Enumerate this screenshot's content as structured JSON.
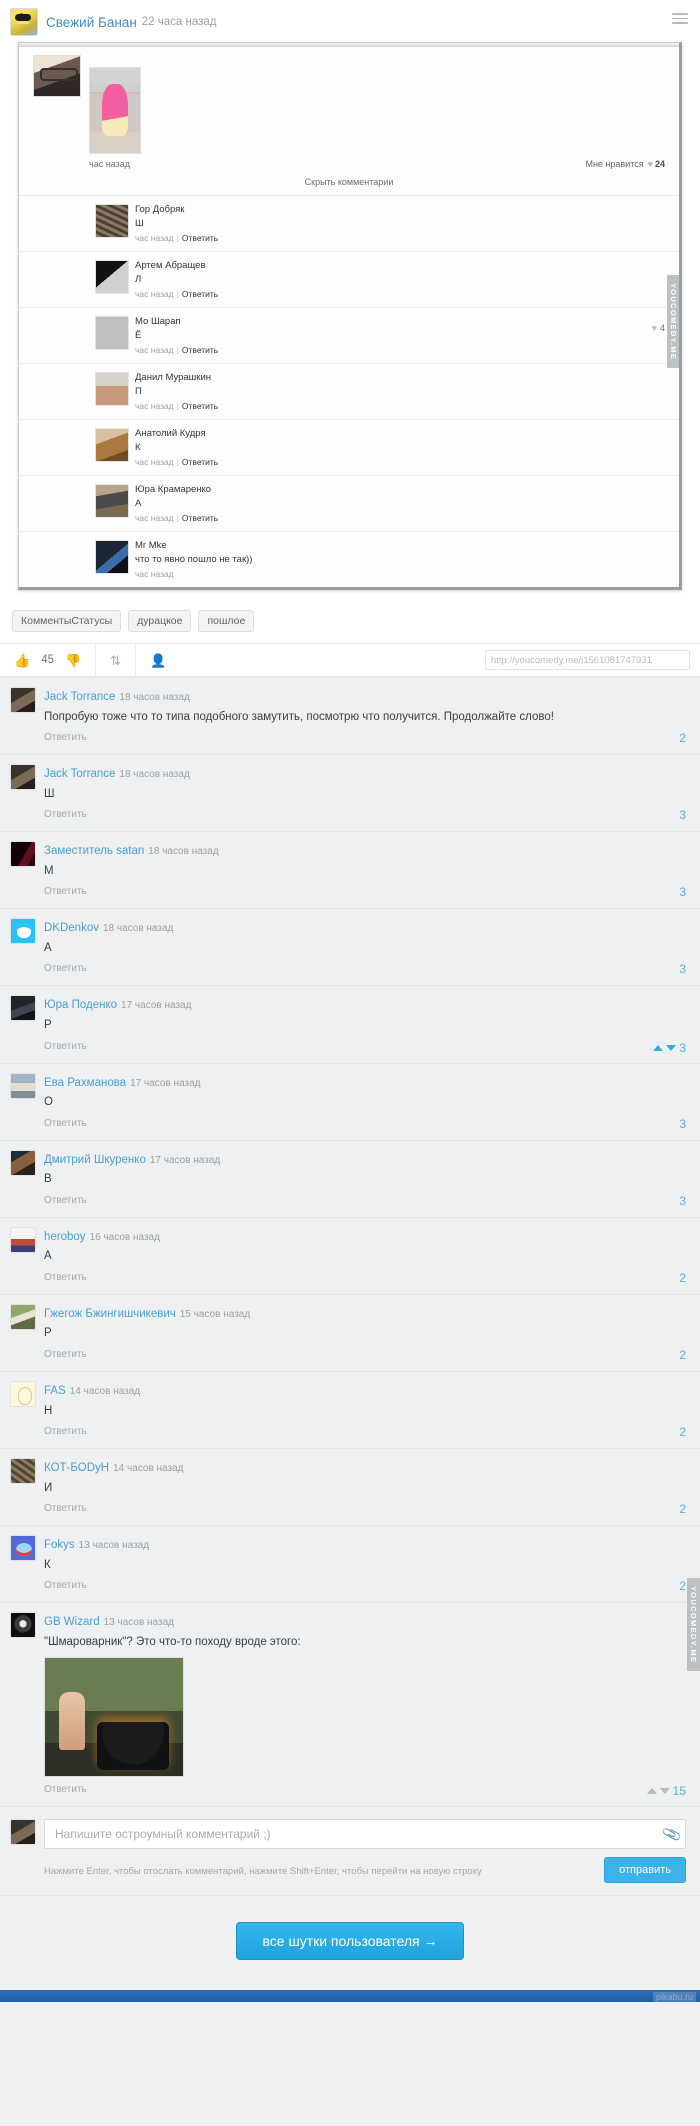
{
  "post": {
    "author": "Свежий Банан",
    "time": "22 часа назад",
    "menu_icon": "hamburger-icon"
  },
  "embed": {
    "photo_time": "час назад",
    "like_label": "Мне нравится",
    "like_heart": "♥",
    "like_count": "24",
    "hide_comments": "Скрыть комментарии",
    "side_watermark": "YOUCOMEDY.ME",
    "side_heart": "♥",
    "side_count": "4",
    "reply_label": "Ответить",
    "time_label": "час назад",
    "comments": [
      {
        "name": "Гор Добряк",
        "text": "Ш",
        "time": "час назад",
        "reply": "Ответить",
        "avatar": "av-cat1"
      },
      {
        "name": "Артем Абращев",
        "text": "Л",
        "time": "час назад",
        "reply": "Ответить",
        "avatar": "av-old"
      },
      {
        "name": "Мо Шарап",
        "text": "Ё",
        "time": "час назад",
        "reply": "Ответить",
        "avatar": "av-gray"
      },
      {
        "name": "Данил Мурашкин",
        "text": "П",
        "time": "час назад",
        "reply": "Ответить",
        "avatar": "av-face"
      },
      {
        "name": "Анатолий Кудря",
        "text": "К",
        "time": "час назад",
        "reply": "Ответить",
        "avatar": "av-dogs"
      },
      {
        "name": "Юра Крамаренко",
        "text": "А",
        "time": "час назад",
        "reply": "Ответить",
        "avatar": "av-kid"
      },
      {
        "name": "Mr Mke",
        "text": "что то явно пошло не так))",
        "time": "час назад",
        "reply": "",
        "avatar": "av-mike"
      }
    ]
  },
  "tags": [
    "КомментыСтатусы",
    "дурацкое",
    "пошлое"
  ],
  "toolbar": {
    "like_icon": "thumbs-up-icon",
    "rating": "45",
    "dislike_icon": "thumbs-down-icon",
    "share_icon": "repost-icon",
    "users_icon": "users-icon",
    "url_value": "http://youcomedy.me/i1561081747931"
  },
  "watermark": "YOUCOMEDY.ME",
  "comments": [
    {
      "name": "Jack Torrance",
      "time": "18 часов назад",
      "text": "Попробую тоже что то типа подобного замутить, посмотрю что получится. Продолжайте слово!",
      "reply": "Ответить",
      "score": "2",
      "avatar": "a1",
      "votes": false
    },
    {
      "name": "Jack Torrance",
      "time": "18 часов назад",
      "text": "Ш",
      "reply": "Ответить",
      "score": "3",
      "avatar": "a1",
      "votes": false
    },
    {
      "name": "Заместитель satan",
      "time": "18 часов назад",
      "text": "М",
      "reply": "Ответить",
      "score": "3",
      "avatar": "a2",
      "votes": false
    },
    {
      "name": "DKDenkov",
      "time": "18 часов назад",
      "text": "А",
      "reply": "Ответить",
      "score": "3",
      "avatar": "a3",
      "votes": false
    },
    {
      "name": "Юра Поденко",
      "time": "17 часов назад",
      "text": "Р",
      "reply": "Ответить",
      "score": "3",
      "avatar": "a4",
      "votes": true
    },
    {
      "name": "Ева Рахманова",
      "time": "17 часов назад",
      "text": "О",
      "reply": "Ответить",
      "score": "3",
      "avatar": "a5",
      "votes": false
    },
    {
      "name": "Дмитрий Шкуренко",
      "time": "17 часов назад",
      "text": "В",
      "reply": "Ответить",
      "score": "3",
      "avatar": "a6",
      "votes": false
    },
    {
      "name": "heroboy",
      "time": "16 часов назад",
      "text": "А",
      "reply": "Ответить",
      "score": "2",
      "avatar": "a7",
      "votes": false
    },
    {
      "name": "Гжегож Бжингишчикевич",
      "time": "15 часов назад",
      "text": "Р",
      "reply": "Ответить",
      "score": "2",
      "avatar": "a8",
      "votes": false
    },
    {
      "name": "FAS",
      "time": "14 часов назад",
      "text": "Н",
      "reply": "Ответить",
      "score": "2",
      "avatar": "a9",
      "votes": false
    },
    {
      "name": "КОТ-БОDуН",
      "time": "14 часов назад",
      "text": "И",
      "reply": "Ответить",
      "score": "2",
      "avatar": "a10",
      "votes": false
    },
    {
      "name": "Fokys",
      "time": "13 часов назад",
      "text": "К",
      "reply": "Ответить",
      "score": "2",
      "avatar": "a11",
      "votes": false
    },
    {
      "name": "GB Wizard",
      "time": "13 часов назад",
      "text": "\"Шмароварник\"? Это что-то походу вроде этого:",
      "reply": "Ответить",
      "score": "15",
      "avatar": "a12",
      "votes": true,
      "has_image": true
    }
  ],
  "form": {
    "placeholder": "Напишите остроумный комментарий ;)",
    "attach_icon": "paperclip-icon",
    "hint": "Нажмите Enter, чтобы отослать комментарий, нажмите Shift+Enter, чтобы перейти на новую строку",
    "send_label": "отправить"
  },
  "footer": {
    "all_jokes_label": "все шутки пользователя →",
    "site_credit": "pikabu.ru"
  }
}
